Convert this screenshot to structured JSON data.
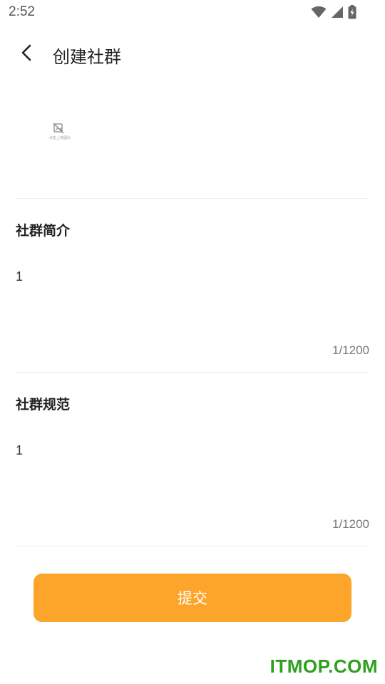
{
  "status_bar": {
    "time": "2:52",
    "icons": [
      "wifi-icon",
      "signal-icon",
      "battery-charging-icon"
    ]
  },
  "header": {
    "back_icon": "chevron-left-icon",
    "title": "创建社群"
  },
  "upload": {
    "icon": "image-placeholder-icon",
    "hint": "点击上传图片"
  },
  "intro": {
    "label": "社群简介",
    "value": "1",
    "counter": "1/1200"
  },
  "rules": {
    "label": "社群规范",
    "value": "1",
    "counter": "1/1200"
  },
  "submit": {
    "label": "提交"
  },
  "watermark": "ITMOP.COM",
  "colors": {
    "accent": "#fda52b",
    "watermark": "#2da01e"
  }
}
